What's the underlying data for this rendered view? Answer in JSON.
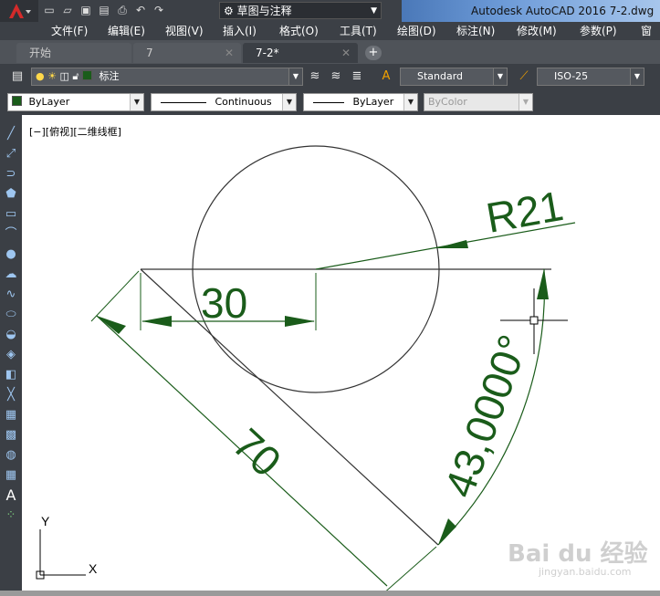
{
  "window": {
    "title": "Autodesk AutoCAD 2016    7-2.dwg",
    "app_button_icon": "autocad-logo-icon",
    "quick_access_icons": [
      "new-icon",
      "open-icon",
      "save-icon",
      "saveas-icon",
      "print-icon",
      "undo-icon",
      "redo-icon"
    ],
    "workspace": "⚙ 草图与注释"
  },
  "menu": [
    "文件(F)",
    "编辑(E)",
    "视图(V)",
    "插入(I)",
    "格式(O)",
    "工具(T)",
    "绘图(D)",
    "标注(N)",
    "修改(M)",
    "参数(P)",
    "窗口"
  ],
  "tabs": [
    {
      "label": "开始",
      "active": false
    },
    {
      "label": "7",
      "active": false
    },
    {
      "label": "7-2*",
      "active": true
    }
  ],
  "ribbon": {
    "layer_name": "标注",
    "text_style": "Standard",
    "dim_style": "ISO-25",
    "color": "ByLayer",
    "linetype_label": "Continuous",
    "lineweight_label": "ByLayer",
    "plot_style": "ByColor"
  },
  "viewport": {
    "label": "[−][俯视][二维线框]",
    "ucs_y": "Y",
    "ucs_x": "X"
  },
  "dimensions": {
    "radius": "R21",
    "linear": "30",
    "aligned": "70",
    "angle": "43,0000°"
  },
  "colors": {
    "dimension_green": "#1a5c1a",
    "geometry_dark": "#333333",
    "chrome_dark": "#3c4046"
  },
  "watermark": {
    "brand": "Bai du 经验",
    "url": "jingyan.baidu.com"
  }
}
